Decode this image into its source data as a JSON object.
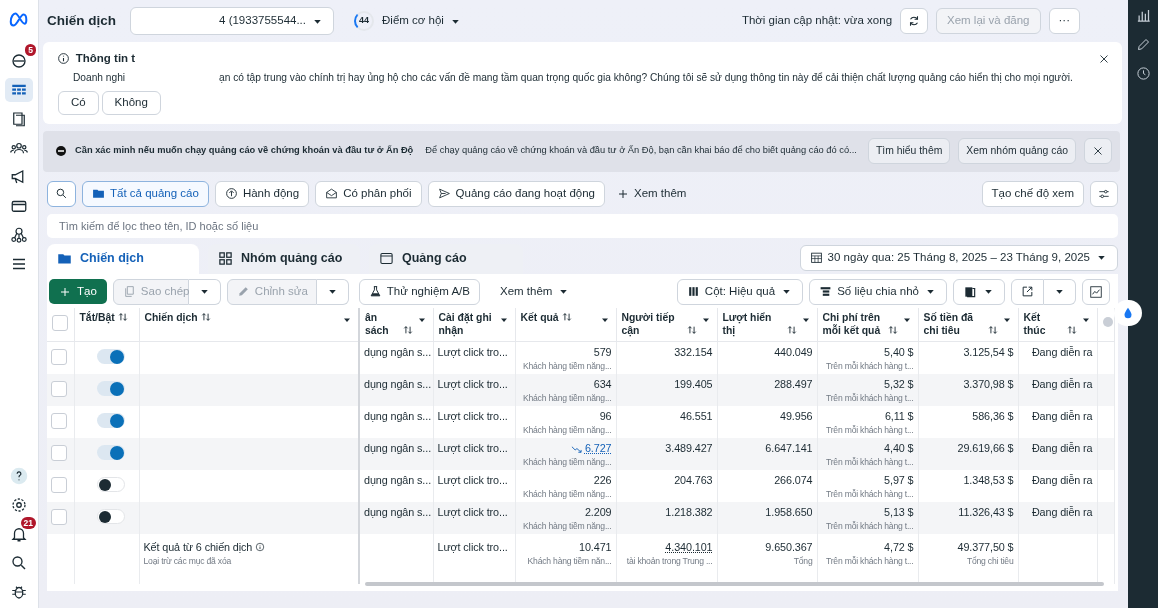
{
  "sidebar": {
    "items": [
      {
        "kind": "logo",
        "selected": false
      },
      {
        "kind": "overview",
        "selected": false,
        "badge": "5"
      },
      {
        "kind": "campaigns",
        "selected": true
      },
      {
        "kind": "pages",
        "selected": false
      },
      {
        "kind": "audiences",
        "selected": false
      },
      {
        "kind": "megaphone",
        "selected": false
      },
      {
        "kind": "billing",
        "selected": false
      },
      {
        "kind": "network",
        "selected": false
      },
      {
        "kind": "menu",
        "selected": false
      }
    ],
    "bottom_items": [
      {
        "kind": "help",
        "selected": false
      },
      {
        "kind": "settings",
        "selected": false
      },
      {
        "kind": "notifications",
        "selected": false,
        "badge": "21"
      },
      {
        "kind": "search",
        "selected": false
      },
      {
        "kind": "bug",
        "selected": false
      }
    ]
  },
  "top_bar": {
    "title": "Chiến dịch",
    "account_selector": "4 (1933755544...",
    "opportunity_score": "44",
    "opportunity_label": "Điểm cơ hội",
    "update_time": "Thời gian cập nhật: vừa xong",
    "review_button": {
      "label": "Xem lại và đăng",
      "disabled": true
    },
    "more_button": "···"
  },
  "notice": {
    "title": "Thông tin t",
    "text_start": "Doanh nghi",
    "text_end": "ạn có tập trung vào chính trị hay ủng hộ cho các vấn đề mang tầm quan trọng quốc gia không? Chúng tôi sẽ sử dụng thông tin này để cải thiện chất lượng quảng cáo hiển thị cho mọi người.",
    "buttons": [
      "Có",
      "Không"
    ]
  },
  "banner": {
    "title": "Cần xác minh nếu muốn chạy quảng cáo về chứng khoán và đầu tư ở Ấn Độ",
    "text": "Để chạy quảng cáo về chứng khoán và đầu tư ở Ấn Độ, bạn cần khai báo để cho biết quảng cáo đó có...",
    "buttons": [
      "Tìm hiểu thêm",
      "Xem nhóm quảng cáo"
    ]
  },
  "filters": [
    {
      "label": "Tất cả quảng cáo",
      "kind": "folder",
      "selected": true
    },
    {
      "label": "Hành động",
      "kind": "action",
      "selected": false
    },
    {
      "label": "Có phân phối",
      "kind": "delivery",
      "selected": false
    },
    {
      "label": "Quảng cáo đang hoạt động",
      "kind": "active",
      "selected": false
    }
  ],
  "more_filters": "Xem thêm",
  "create_view": "Tạo chế độ xem",
  "search": {
    "placeholder": "Tìm kiếm để lọc theo tên, ID hoặc số liệu"
  },
  "tabs": [
    {
      "label": "Chiến dịch",
      "kind": "campaign",
      "selected": true
    },
    {
      "label": "Nhóm quảng cáo",
      "kind": "adset",
      "selected": false
    },
    {
      "label": "Quảng cáo",
      "kind": "ad",
      "selected": false
    }
  ],
  "date_range": "30 ngày qua: 25 Tháng 8, 2025 – 23 Tháng 9, 2025",
  "toolbar": {
    "create": "Tạo",
    "duplicate": {
      "label": "Sao chép",
      "disabled": true
    },
    "edit": {
      "label": "Chỉnh sửa",
      "disabled": true
    },
    "ab_test": "Thử nghiệm A/B",
    "more": "Xem thêm",
    "columns": "Cột: Hiệu quả",
    "breakdown": "Số liệu chia nhỏ"
  },
  "table": {
    "header_checked": false,
    "columns": [
      {
        "label": "Tắt/Bật",
        "sortable": true,
        "menu": false
      },
      {
        "label": "Chiến dịch",
        "sortable": true,
        "menu": true
      },
      {
        "label": "ân sách",
        "sortable": true,
        "menu": true
      },
      {
        "label": "Cài đặt ghi nhận",
        "sortable": false,
        "menu": true
      },
      {
        "label": "Kết quả",
        "sortable": true,
        "menu": true
      },
      {
        "label": "Người tiếp cận",
        "sortable": true,
        "menu": true
      },
      {
        "label": "Lượt hiển thị",
        "sortable": true,
        "menu": true
      },
      {
        "label": "Chi phí trên mỗi kết quả",
        "sortable": true,
        "menu": true
      },
      {
        "label": "Số tiền đã chi tiêu",
        "sortable": true,
        "menu": true
      },
      {
        "label": "Kết thúc",
        "sortable": true,
        "menu": true
      }
    ],
    "rows": [
      {
        "checked": false,
        "on": true,
        "budget": "dụng ngân s...",
        "attribution": "Lượt click tro...",
        "results": "579",
        "results_link": false,
        "results_note": "Khách hàng tiềm năng...",
        "reach": "332.154",
        "impressions": "440.049",
        "cost_per_result": "5,40 $",
        "cost_note": "Trên mỗi khách hàng t...",
        "amount_spent": "3.125,54 $",
        "ends": "Đang diễn ra"
      },
      {
        "checked": false,
        "on": true,
        "budget": "dụng ngân s...",
        "attribution": "Lượt click tro...",
        "results": "634",
        "results_link": false,
        "results_note": "Khách hàng tiềm năng...",
        "reach": "199.405",
        "impressions": "288.497",
        "cost_per_result": "5,32 $",
        "cost_note": "Trên mỗi khách hàng t...",
        "amount_spent": "3.370,98 $",
        "ends": "Đang diễn ra"
      },
      {
        "checked": false,
        "on": true,
        "budget": "dụng ngân s...",
        "attribution": "Lượt click tro...",
        "results": "96",
        "results_link": false,
        "results_note": "Khách hàng tiềm năng...",
        "reach": "46.551",
        "impressions": "49.956",
        "cost_per_result": "6,11 $",
        "cost_note": "Trên mỗi khách hàng t...",
        "amount_spent": "586,36 $",
        "ends": "Đang diễn ra"
      },
      {
        "checked": false,
        "on": true,
        "budget": "dụng ngân s...",
        "attribution": "Lượt click tro...",
        "results": "6.727",
        "results_link": true,
        "results_note": "Khách hàng tiềm năng...",
        "reach": "3.489.427",
        "impressions": "6.647.141",
        "cost_per_result": "4,40 $",
        "cost_note": "Trên mỗi khách hàng t...",
        "amount_spent": "29.619,66 $",
        "ends": "Đang diễn ra"
      },
      {
        "checked": false,
        "on": false,
        "budget": "dụng ngân s...",
        "attribution": "Lượt click tro...",
        "results": "226",
        "results_link": false,
        "results_note": "Khách hàng tiềm năng...",
        "reach": "204.763",
        "impressions": "266.074",
        "cost_per_result": "5,97 $",
        "cost_note": "Trên mỗi khách hàng t...",
        "amount_spent": "1.348,53 $",
        "ends": "Đang diễn ra"
      },
      {
        "checked": false,
        "on": false,
        "budget": "dụng ngân s...",
        "attribution": "Lượt click tro...",
        "results": "2.209",
        "results_link": false,
        "results_note": "Khách hàng tiềm năng...",
        "reach": "1.218.382",
        "impressions": "1.958.650",
        "cost_per_result": "5,13 $",
        "cost_note": "Trên mỗi khách hàng t...",
        "amount_spent": "11.326,43 $",
        "ends": "Đang diễn ra"
      }
    ],
    "summary": {
      "title": "Kết quả từ 6 chiến dịch",
      "subtitle": "Loại trừ các mục đã xóa",
      "attribution": "Lượt click tro...",
      "results": "10.471",
      "results_note": "Khách hàng tiềm năn...",
      "reach": "4.340.101",
      "reach_note": "tài khoản trong Trung ...",
      "impressions": "9.650.367",
      "impressions_note": "Tổng",
      "cost_per_result": "4,72 $",
      "cost_note": "Trên mỗi khách hàng t...",
      "amount_spent": "49.377,50 $",
      "amount_note": "Tổng chi tiêu"
    }
  }
}
